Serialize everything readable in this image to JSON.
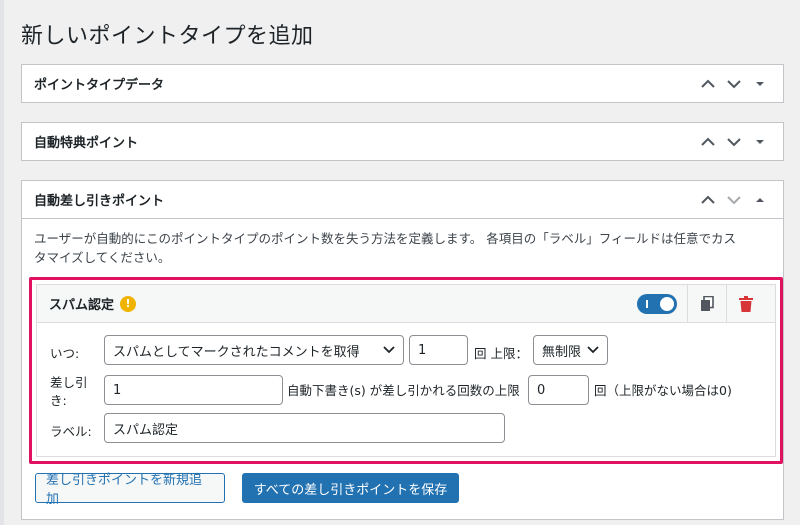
{
  "page": {
    "title": "新しいポイントタイプを追加"
  },
  "panels": [
    {
      "title": "ポイントタイプデータ"
    },
    {
      "title": "自動特典ポイント"
    },
    {
      "title": "自動差し引きポイント"
    }
  ],
  "deduct": {
    "description_line1": "ユーザーが自動的にこのポイントタイプのポイント数を失う方法を定義します。 各項目の「ラベル」フィールドは任意でカス",
    "description_line2": "タマイズしてください。",
    "hook": {
      "title": "スパム認定",
      "warning_glyph": "!",
      "enabled": true,
      "when_label": "いつ:",
      "when_value": "スパムとしてマークされたコメントを取得",
      "times_value": "1",
      "limit_label": "回 上限：",
      "limit_value": "無制限",
      "deduct_label_line1": "差し引",
      "deduct_label_line2": "き:",
      "deduct_value": "1",
      "draft_text": "自動下書き(s) が差し引かれる回数の上限",
      "max_value": "0",
      "max_hint": "回（上限がない場合は0)",
      "label_label": "ラベル:",
      "label_value": "スパム認定"
    },
    "add_button": "差し引きポイントを新規追加",
    "save_button": "すべての差し引きポイントを保存"
  },
  "colors": {
    "accent": "#2271b1",
    "highlight": "#e0115f",
    "warning": "#f0b400",
    "trash": "#d63638"
  },
  "icons": [
    "chevron-up-icon",
    "chevron-down-icon",
    "caret-down-icon",
    "caret-up-icon",
    "warning-icon",
    "toggle-switch",
    "copy-icon",
    "trash-icon"
  ]
}
